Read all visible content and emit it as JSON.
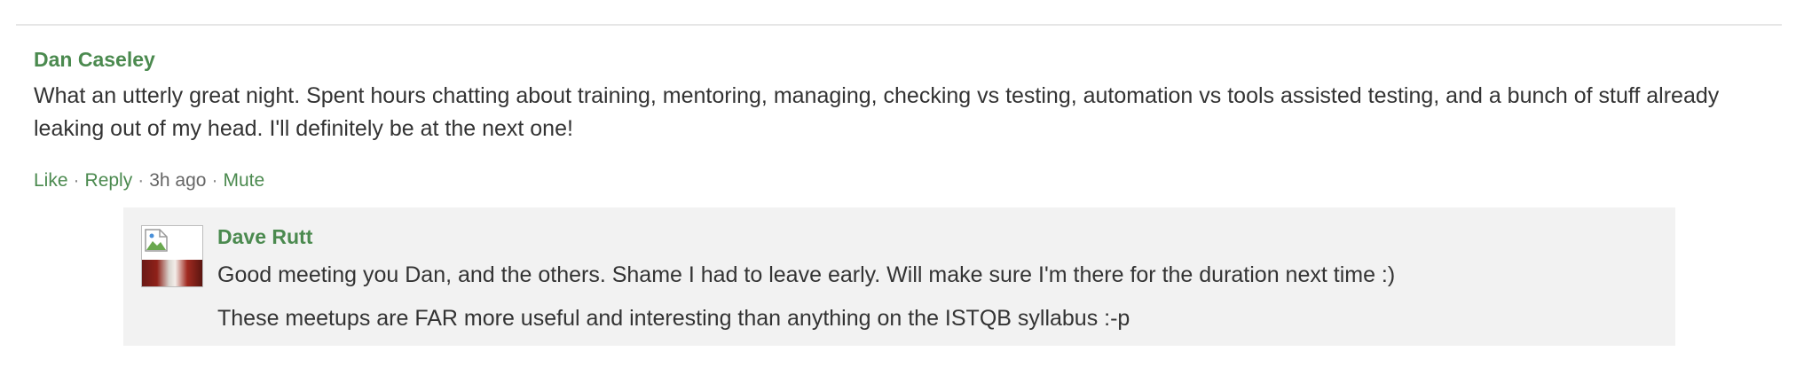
{
  "comment": {
    "author": "Dan Caseley",
    "text": "What an utterly great night. Spent hours chatting about training, mentoring, managing, checking vs testing, automation vs tools assisted testing, and a bunch of stuff already leaking out of my head. I'll definitely be at the next one!",
    "actions": {
      "like": "Like",
      "reply": "Reply",
      "time": "3h ago",
      "mute": "Mute",
      "separator": "·"
    }
  },
  "reply": {
    "author": "Dave Rutt",
    "avatar_icon": "broken-image-icon",
    "paragraphs": [
      "Good meeting you Dan, and the others. Shame I had to leave early. Will make sure I'm there for the duration next time :)",
      "These meetups are FAR more useful and interesting than anything on the ISTQB syllabus :-p"
    ]
  },
  "colors": {
    "link_green": "#4b8a4f",
    "text": "#333333",
    "reply_bg": "#f2f2f2"
  }
}
